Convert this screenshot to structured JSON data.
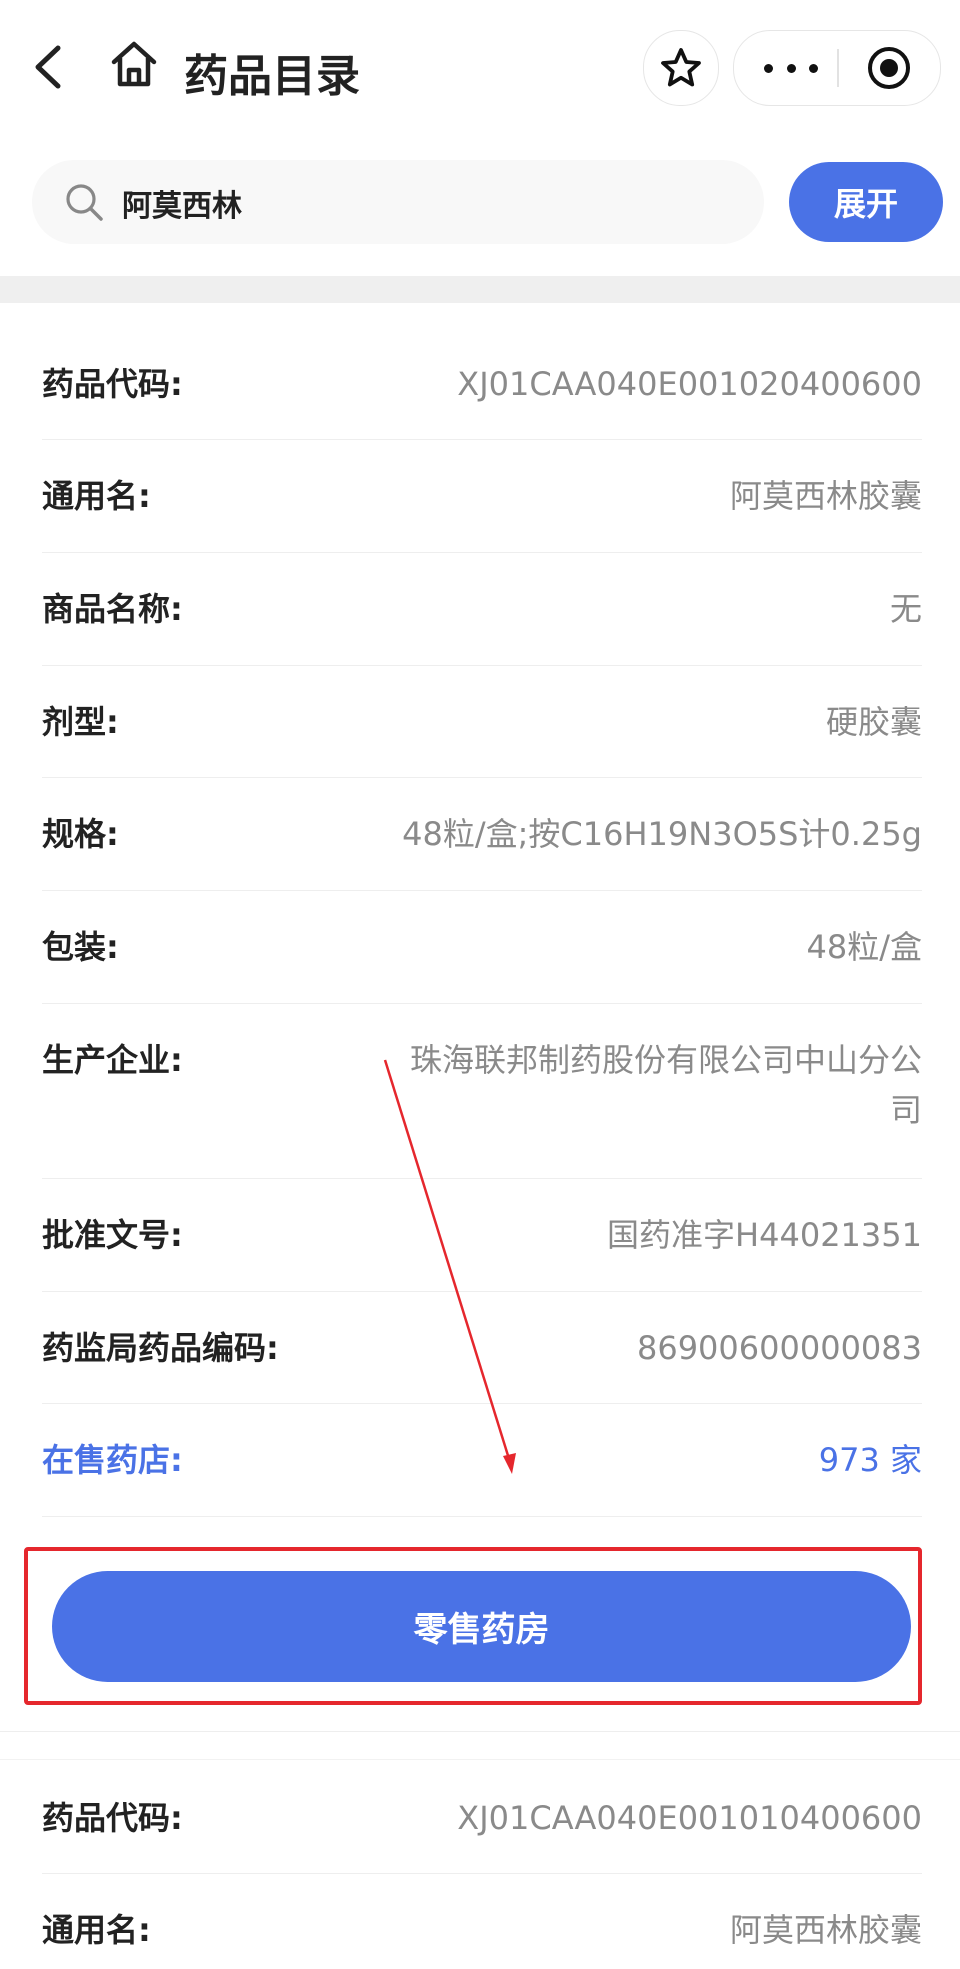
{
  "header": {
    "title": "药品目录",
    "icons": [
      "back-chevron-icon",
      "home-icon",
      "star-icon",
      "more-dots-icon",
      "target-circle-icon"
    ]
  },
  "search": {
    "value": "阿莫西林",
    "expand_label": "展开"
  },
  "colors": {
    "accent": "#4a72e6",
    "annotation_red": "#e5272d",
    "value_gray": "#8a8a8a"
  },
  "drugs": [
    {
      "rows": [
        {
          "label": "药品代码:",
          "value": "XJ01CAA040E001020400600"
        },
        {
          "label": "通用名:",
          "value": "阿莫西林胶囊"
        },
        {
          "label": "商品名称:",
          "value": "无"
        },
        {
          "label": "剂型:",
          "value": "硬胶囊"
        },
        {
          "label": "规格:",
          "value": "48粒/盒;按C16H19N3O5S计0.25g"
        },
        {
          "label": "包装:",
          "value": "48粒/盒"
        },
        {
          "label": "生产企业:",
          "value": "珠海联邦制药股份有限公司中山分公司"
        },
        {
          "label": "批准文号:",
          "value": "国药准字H44021351"
        },
        {
          "label": "药监局药品编码:",
          "value": "86900600000083"
        },
        {
          "label": "在售药店:",
          "value": "973 家"
        }
      ],
      "button_label": "零售药房"
    },
    {
      "rows": [
        {
          "label": "药品代码:",
          "value": "XJ01CAA040E001010400600"
        },
        {
          "label": "通用名:",
          "value": "阿莫西林胶囊"
        }
      ]
    }
  ]
}
